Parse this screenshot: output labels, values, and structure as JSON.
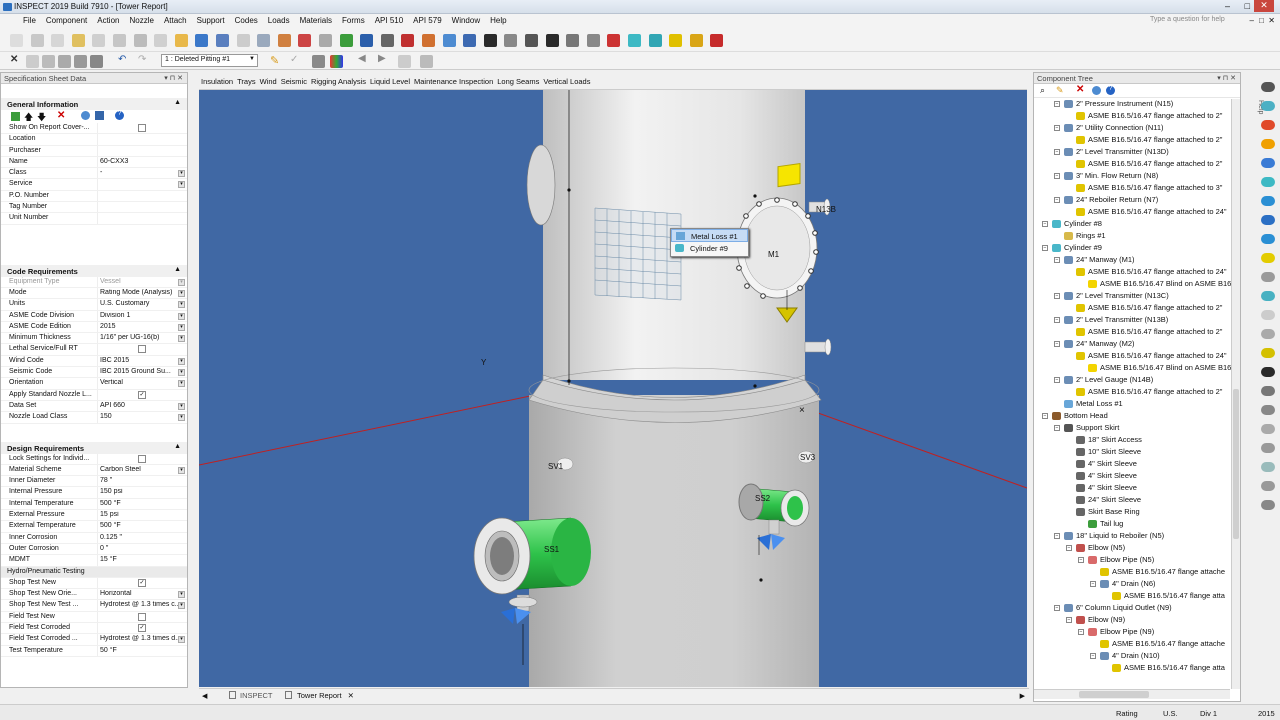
{
  "window": {
    "title": "INSPECT 2019 Build 7910 - [Tower Report]"
  },
  "menu": [
    "File",
    "Component",
    "Action",
    "Nozzle",
    "Attach",
    "Support",
    "Codes",
    "Loads",
    "Materials",
    "Forms",
    "API 510",
    "API 579",
    "Window",
    "Help"
  ],
  "help_search": {
    "placeholder": "Type a question for help"
  },
  "toolbar2": {
    "selection_combo": "1 : Deleted Pitting #1"
  },
  "spec_panel": {
    "title": "Specification Sheet Data",
    "general": {
      "header": "General Information",
      "rows": [
        {
          "label": "Show On Report Cover-...",
          "value": "",
          "type": "checkbox",
          "checked": false
        },
        {
          "label": "Location",
          "value": ""
        },
        {
          "label": "Purchaser",
          "value": ""
        },
        {
          "label": "Name",
          "value": "60-CXX3"
        },
        {
          "label": "Class",
          "value": "-",
          "type": "dropdown"
        },
        {
          "label": "Service",
          "value": "",
          "type": "dropdown"
        },
        {
          "label": "P.O. Number",
          "value": ""
        },
        {
          "label": "Tag Number",
          "value": ""
        },
        {
          "label": "Unit Number",
          "value": ""
        }
      ]
    },
    "code": {
      "header": "Code Requirements",
      "rows": [
        {
          "label": "Equipment Type",
          "value": "Vessel",
          "type": "dropdown",
          "disabled": true
        },
        {
          "label": "Mode",
          "value": "Rating Mode (Analysis)",
          "type": "dropdown"
        },
        {
          "label": "Units",
          "value": "U.S. Customary",
          "type": "dropdown"
        },
        {
          "label": "ASME Code Division",
          "value": "Division 1",
          "type": "dropdown"
        },
        {
          "label": "ASME Code Edition",
          "value": "2015",
          "type": "dropdown"
        },
        {
          "label": "Minimum Thickness",
          "value": "1/16\" per UG-16(b)",
          "type": "dropdown"
        },
        {
          "label": "Lethal Service/Full RT",
          "value": "",
          "type": "checkbox",
          "checked": false
        },
        {
          "label": "Wind Code",
          "value": "IBC 2015",
          "type": "dropdown"
        },
        {
          "label": "Seismic Code",
          "value": "IBC 2015 Ground Su...",
          "type": "dropdown"
        },
        {
          "label": "Orientation",
          "value": "Vertical",
          "type": "dropdown"
        },
        {
          "label": "Apply Standard Nozzle L...",
          "value": "",
          "type": "checkbox",
          "checked": true
        },
        {
          "label": "Data Set",
          "value": "API 660",
          "type": "dropdown"
        },
        {
          "label": "Nozzle Load Class",
          "value": "150",
          "type": "dropdown"
        }
      ]
    },
    "design": {
      "header": "Design Requirements",
      "rows": [
        {
          "label": "Lock Settings for Individ...",
          "value": "",
          "type": "checkbox",
          "checked": false
        },
        {
          "label": "Material Scheme",
          "value": "Carbon Steel",
          "type": "dropdown"
        },
        {
          "label": "Inner Diameter",
          "value": "78 \""
        },
        {
          "label": "Internal Pressure",
          "value": "150 psi"
        },
        {
          "label": "Internal Temperature",
          "value": "500 °F"
        },
        {
          "label": "External Pressure",
          "value": "15 psi"
        },
        {
          "label": "External Temperature",
          "value": "500 °F"
        },
        {
          "label": "Inner Corrosion",
          "value": "0.125 \""
        },
        {
          "label": "Outer Corrosion",
          "value": "0 \""
        },
        {
          "label": "MDMT",
          "value": "15 °F"
        }
      ],
      "hydro_header": "Hydro/Pneumatic Testing",
      "hydro_rows": [
        {
          "label": "Shop Test New",
          "value": "",
          "type": "checkbox",
          "checked": true
        },
        {
          "label": "Shop Test New Orie...",
          "value": "Horizontal",
          "type": "dropdown"
        },
        {
          "label": "Shop Test New Test ...",
          "value": "Hydrotest @ 1.3 times c...",
          "type": "dropdown"
        },
        {
          "label": "Field Test New",
          "value": "",
          "type": "checkbox",
          "checked": false
        },
        {
          "label": "Field Test Corroded",
          "value": "",
          "type": "checkbox",
          "checked": true
        },
        {
          "label": "Field Test Corroded ...",
          "value": "Hydrotest @ 1.3 times d...",
          "type": "dropdown"
        },
        {
          "label": "Test Temperature",
          "value": "50 °F"
        }
      ]
    }
  },
  "view_tabs": [
    "Insulation",
    "Trays",
    "Wind",
    "Seismic",
    "Rigging Analysis",
    "Liquid Level",
    "Maintenance Inspection",
    "Long Seams",
    "Vertical Loads"
  ],
  "viewport": {
    "labels": {
      "n13b": "N13B",
      "m1": "M1",
      "y_axis": "Y",
      "sv1": "SV1",
      "sv3": "SV3",
      "ss1": "SS1",
      "ss2": "SS2"
    },
    "context_menu": [
      "Metal Loss #1",
      "Cylinder #9"
    ]
  },
  "document_tabs": [
    {
      "label": "INSPECT",
      "active": false
    },
    {
      "label": "Tower Report",
      "active": true
    }
  ],
  "component_tree": {
    "title": "Component Tree",
    "items": [
      {
        "label": "2\" Pressure Instrument (N15)",
        "level": 1,
        "icon": "nozzle"
      },
      {
        "label": "ASME B16.5/16.47 flange attached to 2\"",
        "level": 2,
        "icon": "flange"
      },
      {
        "label": "2\" Utility Connection (N11)",
        "level": 1,
        "icon": "nozzle"
      },
      {
        "label": "ASME B16.5/16.47 flange attached to 2\"",
        "level": 2,
        "icon": "flange"
      },
      {
        "label": "2\" Level Transmitter (N13D)",
        "level": 1,
        "icon": "nozzle"
      },
      {
        "label": "ASME B16.5/16.47 flange attached to 2\"",
        "level": 2,
        "icon": "flange"
      },
      {
        "label": "3\" Min. Flow Return (N8)",
        "level": 1,
        "icon": "nozzle"
      },
      {
        "label": "ASME B16.5/16.47 flange attached to 3\"",
        "level": 2,
        "icon": "flange"
      },
      {
        "label": "24\" Reboiler Return (N7)",
        "level": 1,
        "icon": "nozzle"
      },
      {
        "label": "ASME B16.5/16.47 flange attached to 24\"",
        "level": 2,
        "icon": "flange"
      },
      {
        "label": "Cylinder #8",
        "level": 0,
        "icon": "cylinder"
      },
      {
        "label": "Rings #1",
        "level": 1,
        "icon": "rings"
      },
      {
        "label": "Cylinder #9",
        "level": 0,
        "icon": "cylinder"
      },
      {
        "label": "24\" Manway (M1)",
        "level": 1,
        "icon": "nozzle"
      },
      {
        "label": "ASME B16.5/16.47 flange attached to 24\"",
        "level": 2,
        "icon": "flange"
      },
      {
        "label": "ASME B16.5/16.47 Blind on ASME B16",
        "level": 3,
        "icon": "blind"
      },
      {
        "label": "2\" Level Transmitter (N13C)",
        "level": 1,
        "icon": "nozzle"
      },
      {
        "label": "ASME B16.5/16.47 flange attached to 2\"",
        "level": 2,
        "icon": "flange"
      },
      {
        "label": "2\" Level Transmitter (N13B)",
        "level": 1,
        "icon": "nozzle"
      },
      {
        "label": "ASME B16.5/16.47 flange attached to 2\"",
        "level": 2,
        "icon": "flange"
      },
      {
        "label": "24\" Manway (M2)",
        "level": 1,
        "icon": "nozzle"
      },
      {
        "label": "ASME B16.5/16.47 flange attached to 24\"",
        "level": 2,
        "icon": "flange"
      },
      {
        "label": "ASME B16.5/16.47 Blind on ASME B16",
        "level": 3,
        "icon": "blind"
      },
      {
        "label": "2\" Level Gauge (N14B)",
        "level": 1,
        "icon": "nozzle"
      },
      {
        "label": "ASME B16.5/16.47 flange attached to 2\"",
        "level": 2,
        "icon": "flange"
      },
      {
        "label": "Metal Loss #1",
        "level": 1,
        "icon": "metal-loss"
      },
      {
        "label": "Bottom Head",
        "level": 0,
        "icon": "head"
      },
      {
        "label": "Support Skirt",
        "level": 1,
        "icon": "skirt"
      },
      {
        "label": "18\" Skirt Access",
        "level": 2,
        "icon": "skirt-item"
      },
      {
        "label": "10\" Skirt Sleeve",
        "level": 2,
        "icon": "skirt-item"
      },
      {
        "label": "4\" Skirt Sleeve",
        "level": 2,
        "icon": "skirt-item"
      },
      {
        "label": "4\" Skirt Sleeve",
        "level": 2,
        "icon": "skirt-item"
      },
      {
        "label": "4\" Skirt Sleeve",
        "level": 2,
        "icon": "skirt-item"
      },
      {
        "label": "24\" Skirt Sleeve",
        "level": 2,
        "icon": "skirt-item"
      },
      {
        "label": "Skirt Base Ring",
        "level": 2,
        "icon": "skirt-item"
      },
      {
        "label": "Tail lug",
        "level": 3,
        "icon": "lug"
      },
      {
        "label": "18\" Liquid to Reboiler (N5)",
        "level": 1,
        "icon": "nozzle"
      },
      {
        "label": "Elbow (N5)",
        "level": 2,
        "icon": "elbow"
      },
      {
        "label": "Elbow Pipe (N5)",
        "level": 3,
        "icon": "pipe"
      },
      {
        "label": "ASME B16.5/16.47 flange attache",
        "level": 4,
        "icon": "flange"
      },
      {
        "label": "4\" Drain (N6)",
        "level": 4,
        "icon": "nozzle"
      },
      {
        "label": "ASME B16.5/16.47 flange atta",
        "level": 5,
        "icon": "flange"
      },
      {
        "label": "6\" Column Liquid Outlet (N9)",
        "level": 1,
        "icon": "nozzle"
      },
      {
        "label": "Elbow (N9)",
        "level": 2,
        "icon": "elbow"
      },
      {
        "label": "Elbow Pipe (N9)",
        "level": 3,
        "icon": "pipe"
      },
      {
        "label": "ASME B16.5/16.47 flange attache",
        "level": 4,
        "icon": "flange"
      },
      {
        "label": "4\" Drain (N10)",
        "level": 4,
        "icon": "nozzle"
      },
      {
        "label": "ASME B16.5/16.47 flange atta",
        "level": 5,
        "icon": "flange"
      }
    ]
  },
  "right_sidebar": {
    "help_label": "Help"
  },
  "status": {
    "mode": "Rating",
    "units": "U.S.",
    "division": "Div 1",
    "edition": "2015"
  },
  "colors": {
    "viewport_bg": "#4068a4",
    "vessel": "#d8d8d8",
    "nozzle_green": "#2ec24a",
    "highlight": "#f6e500",
    "selection": "#c6dcf5"
  }
}
